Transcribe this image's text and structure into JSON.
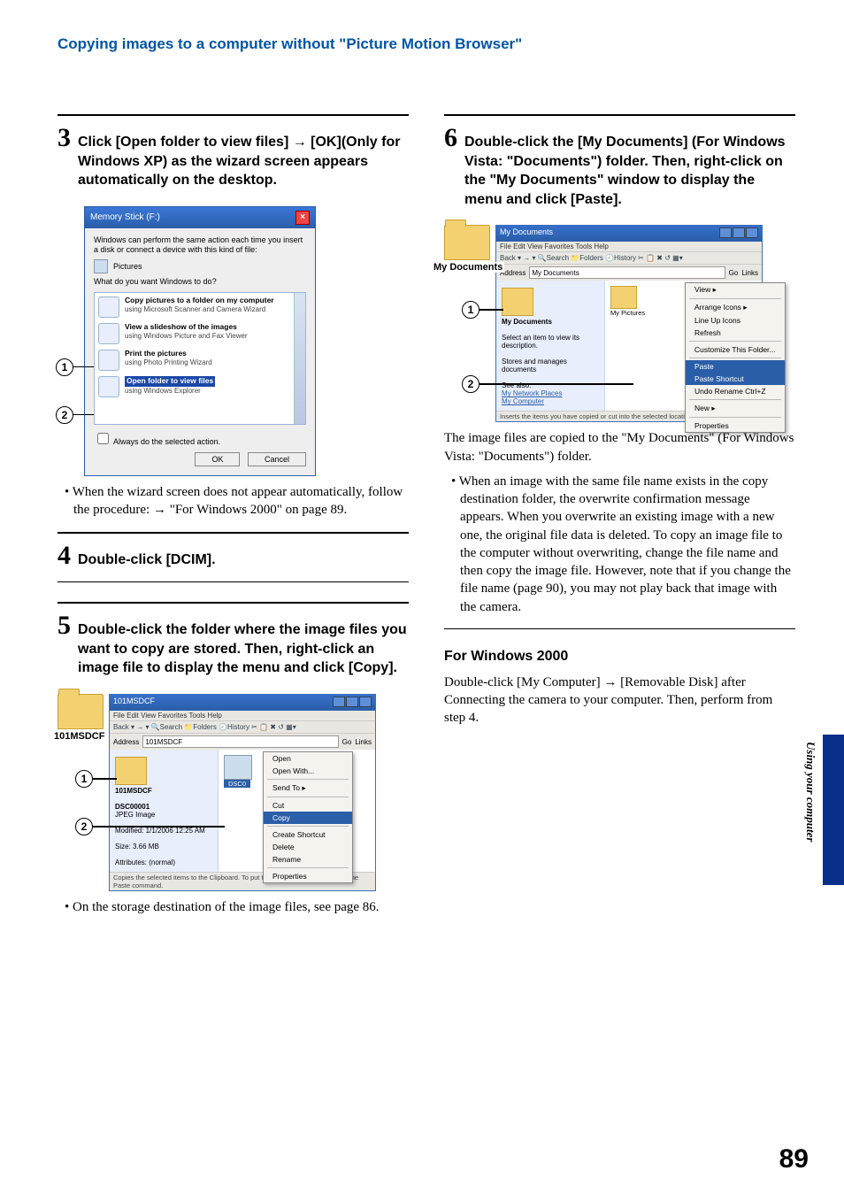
{
  "page_header": "Copying images to a computer without \"Picture Motion Browser\"",
  "side_tab_text": "Using your computer",
  "page_number": "89",
  "left": {
    "step3": {
      "num": "3",
      "text": "Click [Open folder to view files] → [OK](Only for Windows XP) as the wizard screen appears automatically on the desktop."
    },
    "shot1": {
      "marker1": "1",
      "marker2": "2",
      "title": "Memory Stick (F:)",
      "intro": "Windows can perform the same action each time you insert a disk or connect a device with this kind of file:",
      "file_type": "Pictures",
      "prompt": "What do you want Windows to do?",
      "items": [
        {
          "t": "Copy pictures to a folder on my computer",
          "s": "using Microsoft Scanner and Camera Wizard"
        },
        {
          "t": "View a slideshow of the images",
          "s": "using Windows Picture and Fax Viewer"
        },
        {
          "t": "Print the pictures",
          "s": "using Photo Printing Wizard"
        },
        {
          "t": "Open folder to view files",
          "s": "using Windows Explorer"
        }
      ],
      "checkbox": "Always do the selected action.",
      "ok": "OK",
      "cancel": "Cancel"
    },
    "note3": "• When the wizard screen does not appear automatically, follow the procedure: → \"For Windows 2000\" on page 89.",
    "step4": {
      "num": "4",
      "text": "Double-click [DCIM]."
    },
    "step5": {
      "num": "5",
      "text": "Double-click the folder where the image files you want to copy are stored. Then, right-click an image file to display the menu and click [Copy]."
    },
    "shot2": {
      "marker1": "1",
      "marker2": "2",
      "folder_label": "101MSDCF",
      "title": "101MSDCF",
      "menu": "File   Edit   View   Favorites   Tools   Help",
      "toolbar": "Back ▾  →  ▾   🔍Search  📁Folders  🕘History   ✂ 📋 ✖ ↺  ▦▾",
      "addr_label": "Address",
      "addr_value": "101MSDCF",
      "go": "Go",
      "links": "Links",
      "side_title": "101MSDCF",
      "side_line1": "DSC00001",
      "side_line2": "JPEG Image",
      "side_line3": "Modified: 1/1/2006 12:25 AM",
      "side_line4": "Size: 3.66 MB",
      "side_line5": "Attributes: (normal)",
      "ctx": [
        "Open",
        "Open With...",
        "—",
        "Send To   ▸",
        "—",
        "Cut",
        "Copy",
        "—",
        "Create Shortcut",
        "Delete",
        "Rename",
        "—",
        "Properties"
      ],
      "ctx_selected": "Copy",
      "status": "Copies the selected items to the Clipboard. To put them in the new location, use the Paste command."
    },
    "note5": "• On the storage destination of the image files, see page 86."
  },
  "right": {
    "step6": {
      "num": "6",
      "text": "Double-click the [My Documents] (For Windows Vista: \"Documents\") folder. Then, right-click on the \"My Documents\" window to display the menu and click [Paste]."
    },
    "shot3": {
      "marker1": "1",
      "marker2": "2",
      "folder_label": "My Documents",
      "title": "My Documents",
      "menu": "File   Edit   View   Favorites   Tools   Help",
      "toolbar": "Back ▾  →  ▾   🔍Search  📁Folders  🕘History   ✂ 📋 ✖ ↺  ▦▾",
      "addr_label": "Address",
      "addr_value": "My Documents",
      "go": "Go",
      "links": "Links",
      "side_title": "My Documents",
      "side_line1": "Select an item to view its description.",
      "side_line2": "Stores and manages documents",
      "side_line3": "See also:",
      "side_link1": "My Network Places",
      "side_link2": "My Computer",
      "main_thumb_label": "My Pictures",
      "ctx": [
        "View   ▸",
        "—",
        "Arrange Icons   ▸",
        "Line Up Icons",
        "Refresh",
        "—",
        "Customize This Folder...",
        "—",
        "Paste",
        "Paste Shortcut",
        "Undo Rename        Ctrl+Z",
        "—",
        "New   ▸",
        "—",
        "Properties"
      ],
      "ctx_selected": "Paste",
      "status": "Inserts the items you have copied or cut into the selected location."
    },
    "result_para": "The image files are copied to the \"My Documents\" (For Windows Vista: \"Documents\") folder.",
    "note6": "• When an image with the same file name exists in the copy destination folder, the overwrite confirmation message appears. When you overwrite an existing image with a new one, the original file data is deleted. To copy an image file to the computer without overwriting, change the file name and then copy the image file. However, note that if you change the file name (page 90), you may not play back that image with the camera.",
    "win2000_head": "For Windows 2000",
    "win2000_para": "Double-click [My Computer] → [Removable Disk] after Connecting the camera to your computer. Then, perform from step 4."
  }
}
